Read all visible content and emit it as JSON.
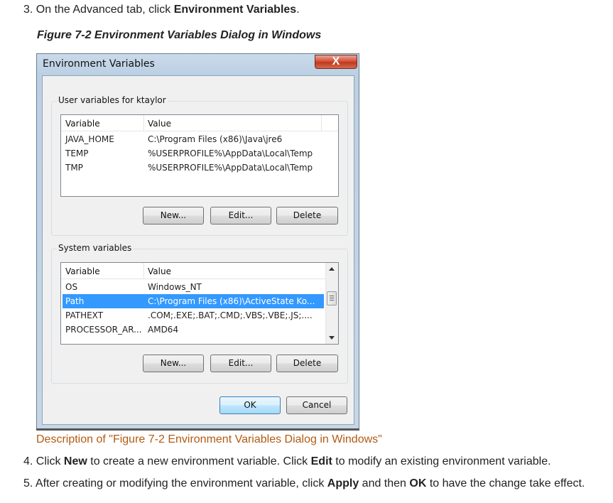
{
  "doc": {
    "step3": {
      "prefix": "3. On the Advanced tab, click ",
      "bold": "Environment Variables",
      "suffix": "."
    },
    "figure_title": "Figure 7-2 Environment Variables Dialog in Windows",
    "description_link": "Description of \"Figure 7-2 Environment Variables Dialog in Windows\"",
    "step4": {
      "p1": "4. Click ",
      "b1": "New",
      "p2": " to create a new environment variable. Click ",
      "b2": "Edit",
      "p3": " to modify an existing environment variable."
    },
    "step5": {
      "p1": "5. After creating or modifying the environment variable, click ",
      "b1": "Apply",
      "p2": " and then ",
      "b2": "OK",
      "p3": " to have the change take effect."
    }
  },
  "dialog": {
    "title": "Environment Variables",
    "close_label": "X",
    "user_group": {
      "label": "User variables for ktaylor",
      "columns": [
        "Variable",
        "Value"
      ],
      "rows": [
        {
          "variable": "JAVA_HOME",
          "value": "C:\\Program Files (x86)\\Java\\jre6"
        },
        {
          "variable": "TEMP",
          "value": "%USERPROFILE%\\AppData\\Local\\Temp"
        },
        {
          "variable": "TMP",
          "value": "%USERPROFILE%\\AppData\\Local\\Temp"
        }
      ],
      "buttons": {
        "new": "New...",
        "edit": "Edit...",
        "delete": "Delete"
      }
    },
    "system_group": {
      "label": "System variables",
      "columns": [
        "Variable",
        "Value"
      ],
      "rows": [
        {
          "variable": "OS",
          "value": "Windows_NT"
        },
        {
          "variable": "Path",
          "value": "C:\\Program Files (x86)\\ActiveState Ko...",
          "selected": true
        },
        {
          "variable": "PATHEXT",
          "value": ".COM;.EXE;.BAT;.CMD;.VBS;.VBE;.JS;...."
        },
        {
          "variable": "PROCESSOR_AR...",
          "value": "AMD64"
        }
      ],
      "buttons": {
        "new": "New...",
        "edit": "Edit...",
        "delete": "Delete"
      }
    },
    "ok_label": "OK",
    "cancel_label": "Cancel"
  },
  "colors": {
    "link": "#b35a12",
    "selection": "#3399ff"
  }
}
